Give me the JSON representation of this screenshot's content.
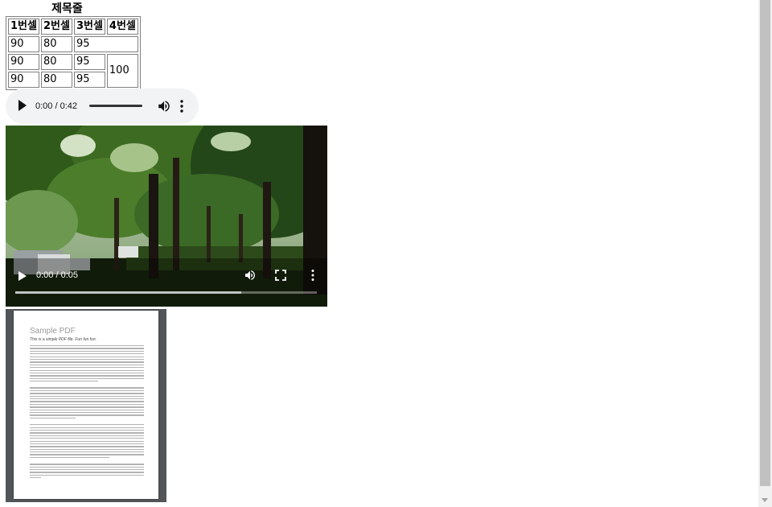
{
  "table": {
    "caption": "제목줄",
    "headers": [
      "1번셀",
      "2번셀",
      "3번셀",
      "4번셀"
    ],
    "rows": [
      [
        "90",
        "80",
        "95"
      ],
      [
        "90",
        "80",
        "95",
        "100"
      ],
      [
        "90",
        "80",
        "95"
      ]
    ]
  },
  "audio": {
    "time": "0:00 / 0:42",
    "icons": [
      "play-icon",
      "volume-icon",
      "more-options-icon"
    ]
  },
  "video": {
    "time": "0:00 / 0:05",
    "icons": [
      "play-icon",
      "volume-icon",
      "fullscreen-icon",
      "more-options-icon"
    ],
    "buffered_fraction": 0.75
  },
  "pdf": {
    "title": "Sample PDF",
    "subtitle": "This is a simple PDF file. Fun fun fun."
  },
  "colors": {
    "audio_bg": "#f1f3f4",
    "pdf_viewer_bg": "#525659",
    "table_border": "#808080"
  }
}
